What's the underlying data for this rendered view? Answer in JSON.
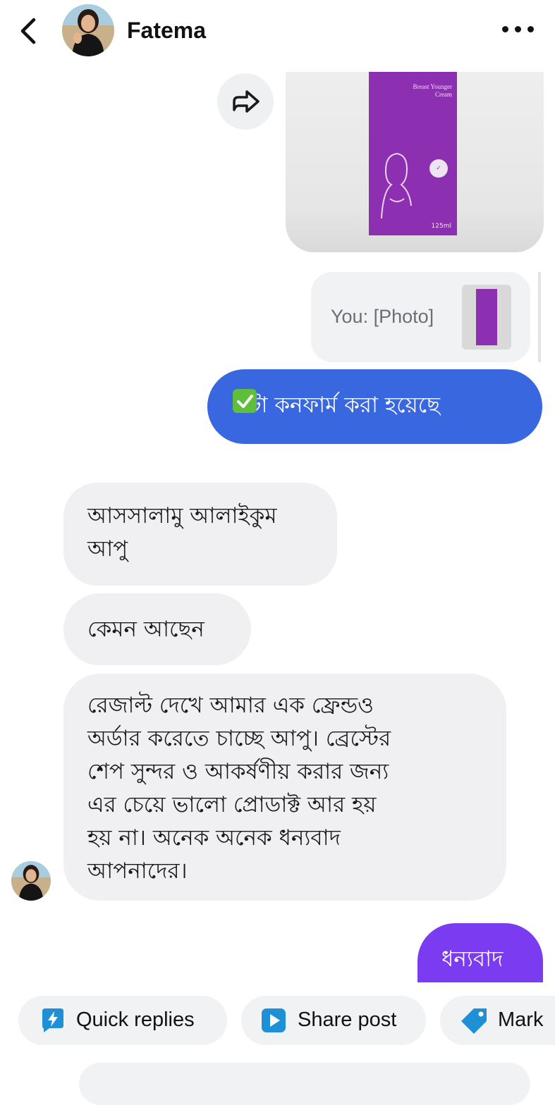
{
  "header": {
    "contact_name": "Fatema"
  },
  "product": {
    "name_lines": "Breast Younger\nCream",
    "volume": "125ml"
  },
  "reply_preview": {
    "text": "You: [Photo]"
  },
  "messages": [
    {
      "direction": "outgoing",
      "text": "এটা কনফার্ম করা হয়েছে"
    },
    {
      "direction": "incoming",
      "text": "আসসালামু আলাইকুম\nআপু"
    },
    {
      "direction": "incoming",
      "text": "কেমন আছেন"
    },
    {
      "direction": "incoming",
      "text": "রেজাল্ট দেখে আমার এক ফ্রেন্ডও\nঅর্ডার করেতে চাচ্ছে আপু। ব্রেস্টের\nশেপ সুন্দর ও আকর্ষণীয় করার জন্য\nএর চেয়ে ভালো প্রোডাক্ট আর হয়\nহয় না। অনেক অনেক ধন্যবাদ\nআপনাদের।"
    },
    {
      "direction": "outgoing",
      "text": "ধন্যবাদ"
    }
  ],
  "quick_actions": [
    {
      "label": "Quick replies",
      "icon": "lightning-icon"
    },
    {
      "label": "Share post",
      "icon": "play-icon"
    },
    {
      "label": "Mark",
      "icon": "tag-icon"
    }
  ],
  "colors": {
    "outgoing_bubble": "#3867e0",
    "outgoing_bubble_2": "#7b3bf0",
    "incoming_bubble": "#f0f0f2",
    "chip_icon": "#1f8fd6",
    "product_box": "#8c2fb0"
  }
}
